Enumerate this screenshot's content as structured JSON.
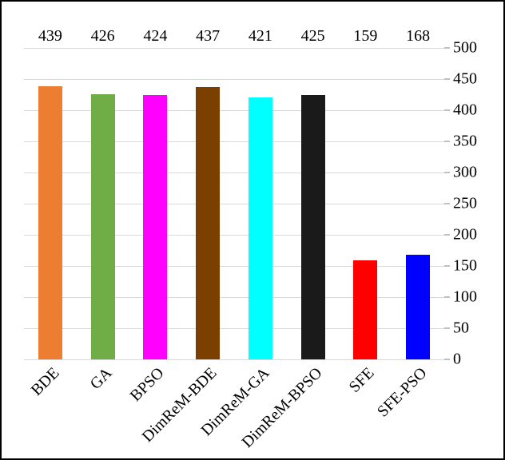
{
  "chart_data": {
    "type": "bar",
    "categories": [
      "BDE",
      "GA",
      "BPSO",
      "DimReM-BDE",
      "DimReM-GA",
      "DimReM-BPSO",
      "SFE",
      "SFE-PSO"
    ],
    "values": [
      439,
      426,
      424,
      437,
      421,
      425,
      159,
      168
    ],
    "colors": [
      "#ed7d31",
      "#70ad47",
      "#ff00ff",
      "#7b3f00",
      "#00ffff",
      "#1a1a1a",
      "#ff0000",
      "#0000ff"
    ],
    "title": "",
    "xlabel": "",
    "ylabel": "",
    "ylim": [
      0,
      500
    ],
    "yticks": [
      0,
      50,
      100,
      150,
      200,
      250,
      300,
      350,
      400,
      450,
      500
    ]
  }
}
